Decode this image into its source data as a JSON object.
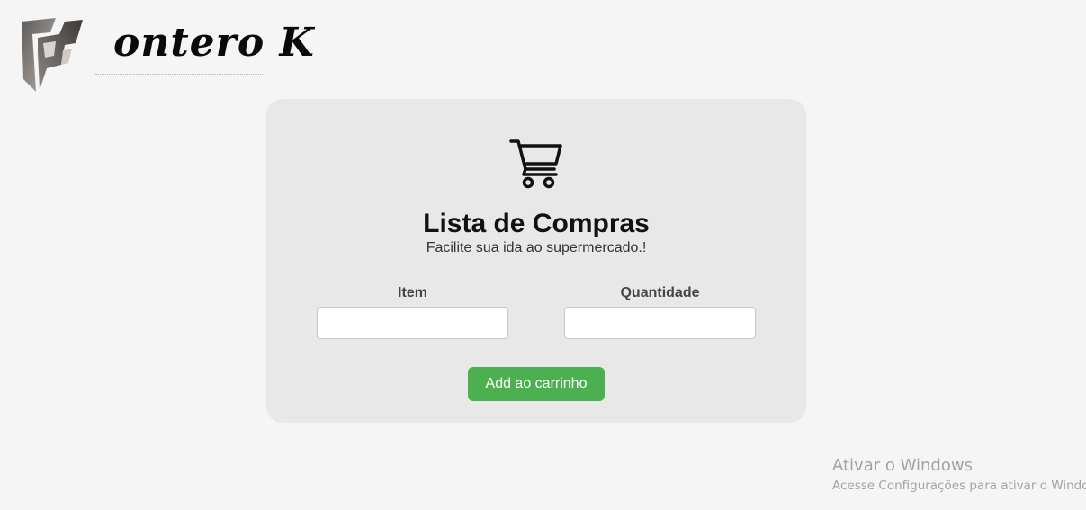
{
  "logo": {
    "text": "ontero K",
    "icon": "logo-mark"
  },
  "card": {
    "icon": "cart-icon",
    "title": "Lista de Compras",
    "subtitle": "Facilite sua ida ao supermercado.!",
    "item_label": "Item",
    "item_value": "",
    "quantity_label": "Quantidade",
    "quantity_value": "",
    "add_button_label": "Add ao carrinho"
  },
  "colors": {
    "page_background": "#f5f5f5",
    "card_background": "#e8e8e8",
    "button": "#4caf50"
  },
  "watermark": {
    "title": "Ativar o Windows",
    "subtitle": "Acesse Configurações para ativar o Windows."
  }
}
